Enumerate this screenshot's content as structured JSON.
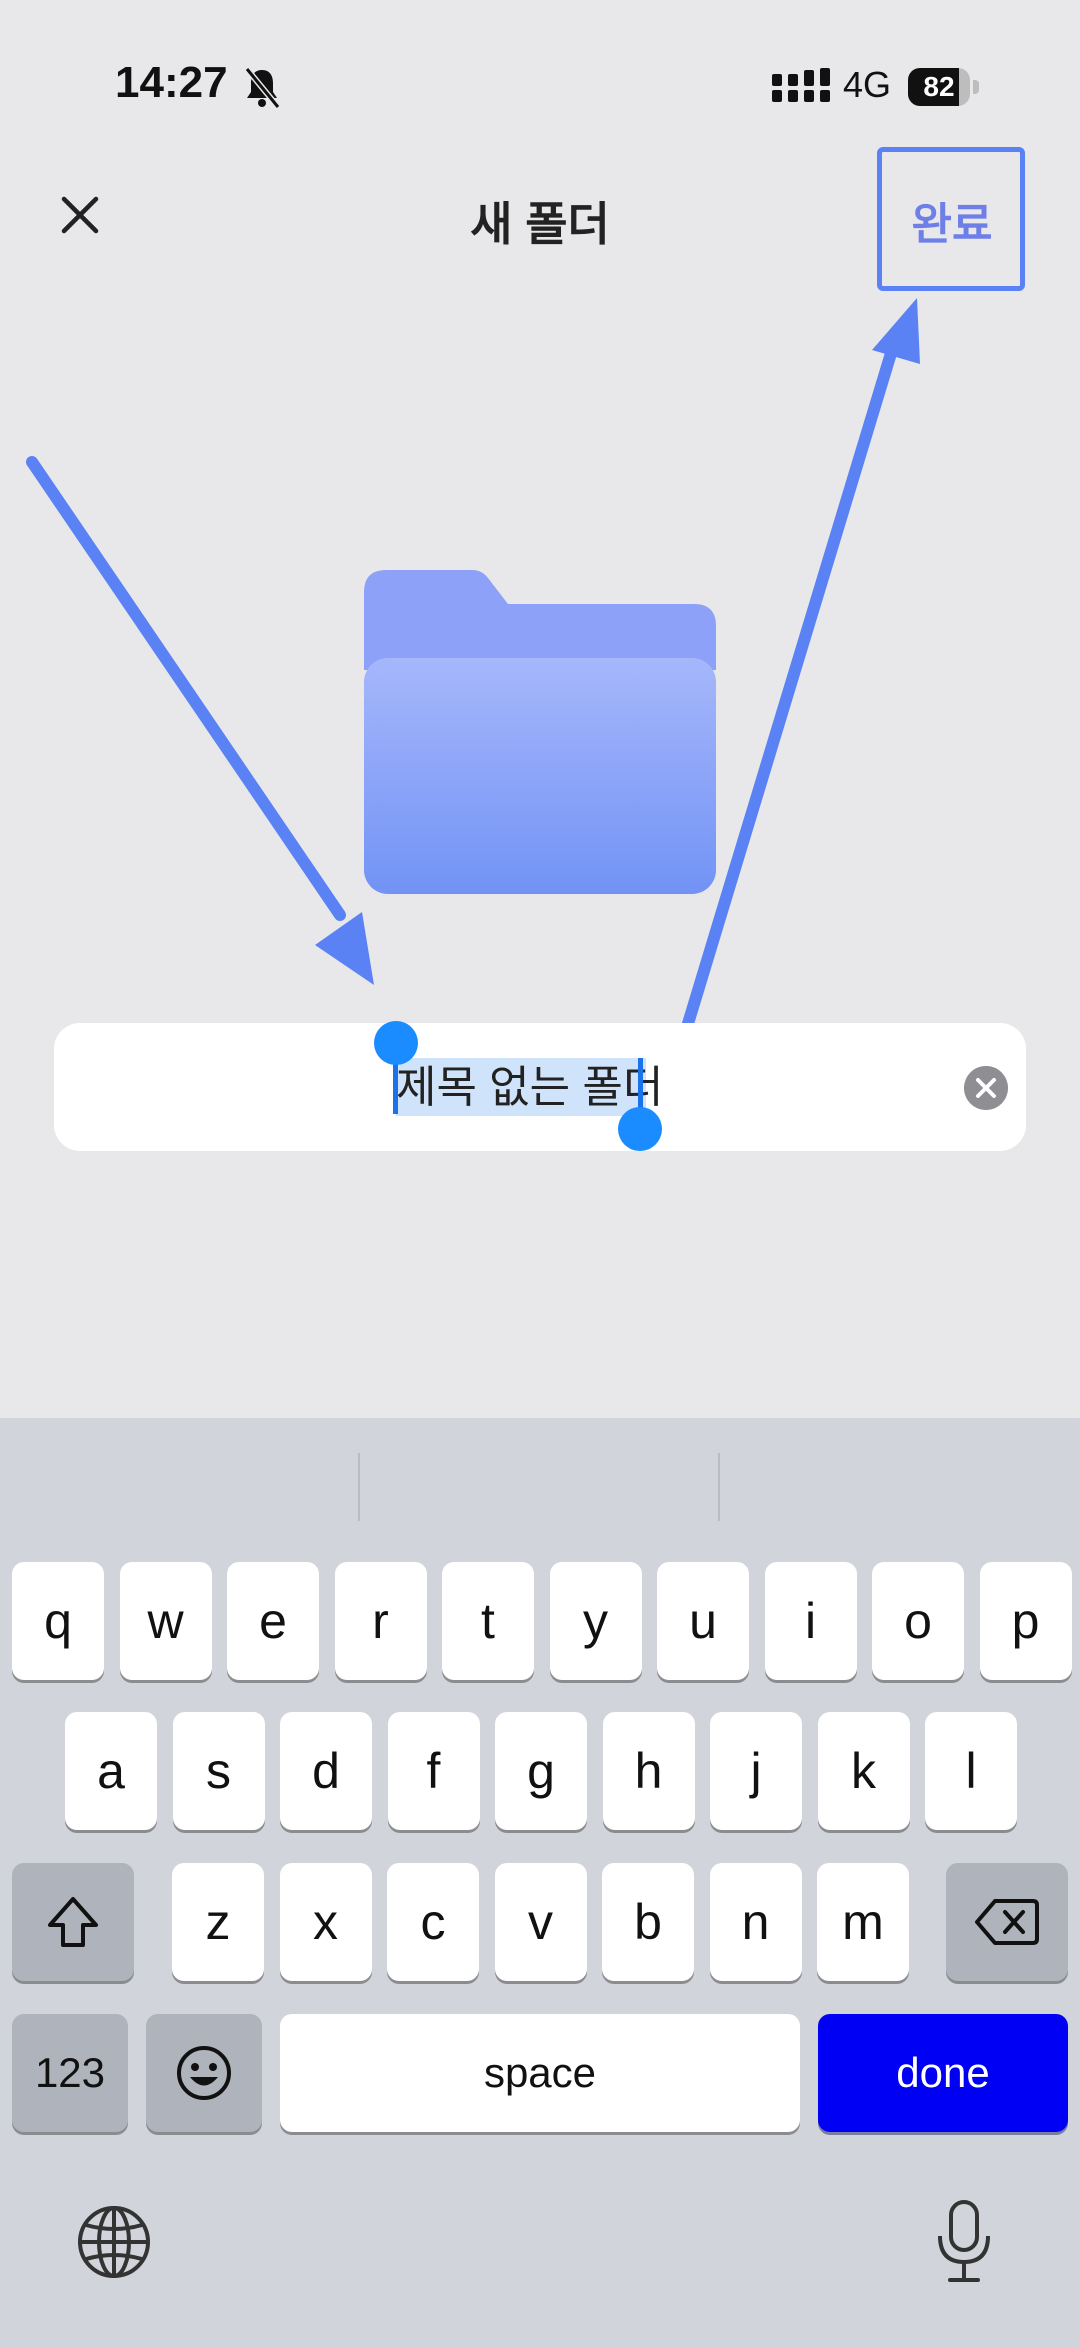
{
  "status_bar": {
    "time": "14:27",
    "network": "4G",
    "battery": "82",
    "battery_level": 0.82,
    "icons": [
      "bell-muted-icon",
      "signal-icon",
      "battery-icon"
    ]
  },
  "nav": {
    "title": "새 폴더",
    "done_label": "완료",
    "close_icon": "close-icon"
  },
  "folder": {
    "icon": "folder-icon",
    "colors": {
      "top": "#a3b4fb",
      "bottom": "#7394f5",
      "back": "#8fa3f8"
    }
  },
  "name_field": {
    "value": "제목 없는 폴더",
    "clear_icon": "clear-icon"
  },
  "annotations": {
    "arrow_color": "#5b82f5"
  },
  "keyboard": {
    "row1": [
      "q",
      "w",
      "e",
      "r",
      "t",
      "y",
      "u",
      "i",
      "o",
      "p"
    ],
    "row2": [
      "a",
      "s",
      "d",
      "f",
      "g",
      "h",
      "j",
      "k",
      "l"
    ],
    "row3": [
      "z",
      "x",
      "c",
      "v",
      "b",
      "n",
      "m"
    ],
    "numbers_label": "123",
    "space_label": "space",
    "done_label": "done",
    "icons": [
      "shift-icon",
      "backspace-icon",
      "emoji-icon",
      "globe-icon",
      "microphone-icon"
    ]
  }
}
